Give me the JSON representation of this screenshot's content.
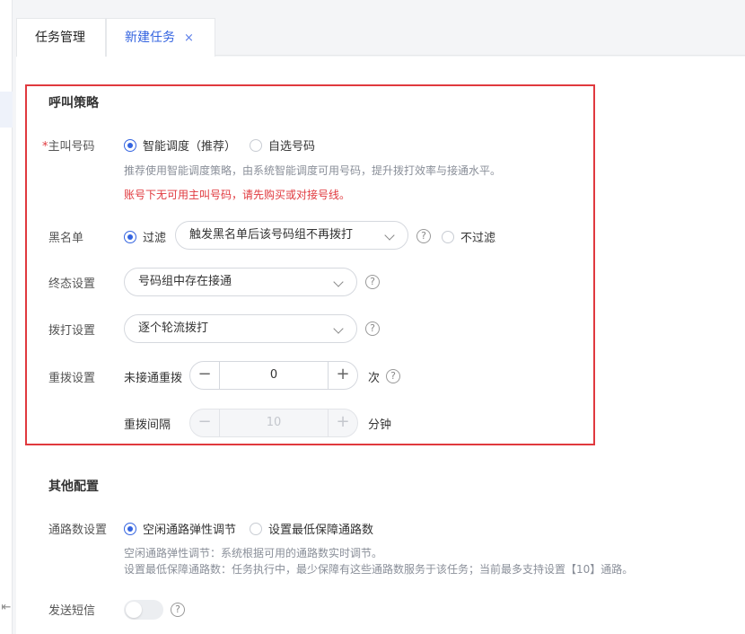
{
  "tabs": [
    {
      "label": "任务管理"
    },
    {
      "label": "新建任务",
      "close": "×"
    }
  ],
  "call_strategy": {
    "title": "呼叫策略",
    "caller": {
      "required_mark": "*",
      "label": "主叫号码",
      "options": [
        "智能调度（推荐）",
        "自选号码"
      ],
      "selected": "智能调度（推荐）",
      "help": "推荐使用智能调度策略，由系统智能调度可用号码，提升拨打效率与接通水平。",
      "error": "账号下无可用主叫号码，请先购买或对接号线。"
    },
    "blacklist": {
      "label": "黑名单",
      "filter_label": "过滤",
      "select_value": "触发黑名单后该号码组不再拨打",
      "no_filter_label": "不过滤",
      "selected": "过滤"
    },
    "final_state": {
      "label": "终态设置",
      "select_value": "号码组中存在接通"
    },
    "dial": {
      "label": "拨打设置",
      "select_value": "逐个轮流拨打"
    },
    "redial": {
      "label": "重拨设置",
      "unanswered_label": "未接通重拨",
      "count": "0",
      "count_unit": "次",
      "interval_label": "重拨间隔",
      "interval": "10",
      "interval_unit": "分钟"
    }
  },
  "other_config": {
    "title": "其他配置",
    "channels": {
      "label": "通路数设置",
      "options": [
        "空闲通路弹性调节",
        "设置最低保障通路数"
      ],
      "selected": "空闲通路弹性调节",
      "help_line1": "空闲通路弹性调节：系统根据可用的通路数实时调节。",
      "help_line2": "设置最低保障通路数：任务执行中，最少保障有这些通路数服务于该任务；当前最多支持设置【10】通路。"
    },
    "sms": {
      "label": "发送短信",
      "enabled": false
    }
  },
  "icons": {
    "help": "?",
    "minus": "−",
    "plus": "+",
    "collapse": "⇤"
  },
  "colors": {
    "accent": "#3464e0",
    "error": "#e0393e",
    "highlight_border": "#e0393e"
  }
}
